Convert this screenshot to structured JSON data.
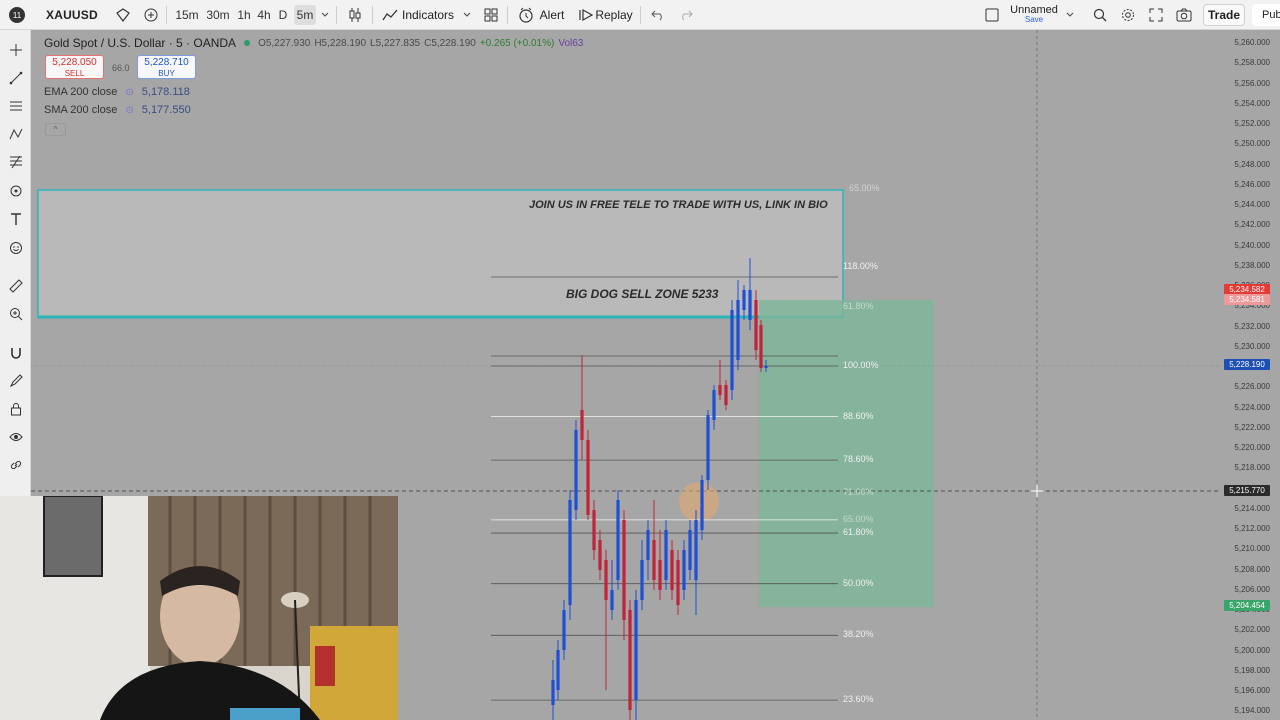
{
  "topbar": {
    "symbol": "XAUUSD",
    "notif_count": "11",
    "intervals": [
      "15m",
      "30m",
      "1h",
      "4h",
      "D",
      "5m"
    ],
    "indicators_label": "Indicators",
    "alert_label": "Alert",
    "replay_label": "Replay",
    "layout_name": "Unnamed",
    "layout_sub": "Save",
    "trade_label": "Trade",
    "publish_label": "Pub"
  },
  "legend": {
    "title": "Gold Spot / U.S. Dollar · 5 · OANDA",
    "open": "O5,227.930",
    "high": "H5,228.190",
    "low": "L5,227.835",
    "close": "C5,228.190",
    "change": "+0.265 (+0.01%)",
    "volume": "Vol63",
    "sell_price": "5,228.050",
    "sell_label": "SELL",
    "spread": "66.0",
    "buy_price": "5,228.710",
    "buy_label": "BUY"
  },
  "indicators": [
    {
      "name": "EMA 200 close",
      "value": "5,178.118"
    },
    {
      "name": "SMA 200 close",
      "value": "5,177.550"
    }
  ],
  "annotations": {
    "promo": "JOIN US IN FREE TELE TO TRADE WITH US, LINK IN BIO",
    "zone": "BIG DOG SELL ZONE 5233"
  },
  "fib_levels": [
    {
      "label": "65.00%",
      "price": 5245.6,
      "muted": true
    },
    {
      "label": "118.00%",
      "price": 5237.9
    },
    {
      "label": "61.80%",
      "price": 5233.9,
      "muted": true
    },
    {
      "label": "100.00%",
      "price": 5228.1
    },
    {
      "label": "88.60%",
      "price": 5223.1
    },
    {
      "label": "78.60%",
      "price": 5218.8
    },
    {
      "label": "71.00%",
      "price": 5215.6,
      "muted": true
    },
    {
      "label": "65.00%",
      "price": 5212.9,
      "muted": true
    },
    {
      "label": "61.80%",
      "price": 5211.6
    },
    {
      "label": "50.00%",
      "price": 5206.6
    },
    {
      "label": "38.20%",
      "price": 5201.5
    },
    {
      "label": "23.60%",
      "price": 5195.1
    }
  ],
  "price_axis": {
    "labels": [
      "5,260.000",
      "5,258.000",
      "5,256.000",
      "5,254.000",
      "5,252.000",
      "5,250.000",
      "5,248.000",
      "5,246.000",
      "5,244.000",
      "5,242.000",
      "5,240.000",
      "5,238.000",
      "5,236.000",
      "5,234.000",
      "5,232.000",
      "5,230.000",
      "5,228.000",
      "5,226.000",
      "5,224.000",
      "5,222.000",
      "5,220.000",
      "5,218.000",
      "5,216.000",
      "5,214.000",
      "5,212.000",
      "5,210.000",
      "5,208.000",
      "5,206.000",
      "5,204.000",
      "5,202.000",
      "5,200.000",
      "5,198.000",
      "5,196.000",
      "5,194.000"
    ],
    "tags": [
      {
        "text": "5,234.582",
        "color": "#e53935"
      },
      {
        "text": "5,234.581",
        "color": "#ef9a9a"
      },
      {
        "text": "5,228.190",
        "color": "#1e4fb5"
      },
      {
        "text": "5,215.770",
        "color": "#2b2b2b"
      },
      {
        "text": "5,204.454",
        "color": "#3aa56b"
      }
    ]
  },
  "colors": {
    "bull": "#1f4fd6",
    "bear": "#c0243a",
    "zone_border": "#2bb5b8",
    "target_zone": "#7fb59a"
  }
}
